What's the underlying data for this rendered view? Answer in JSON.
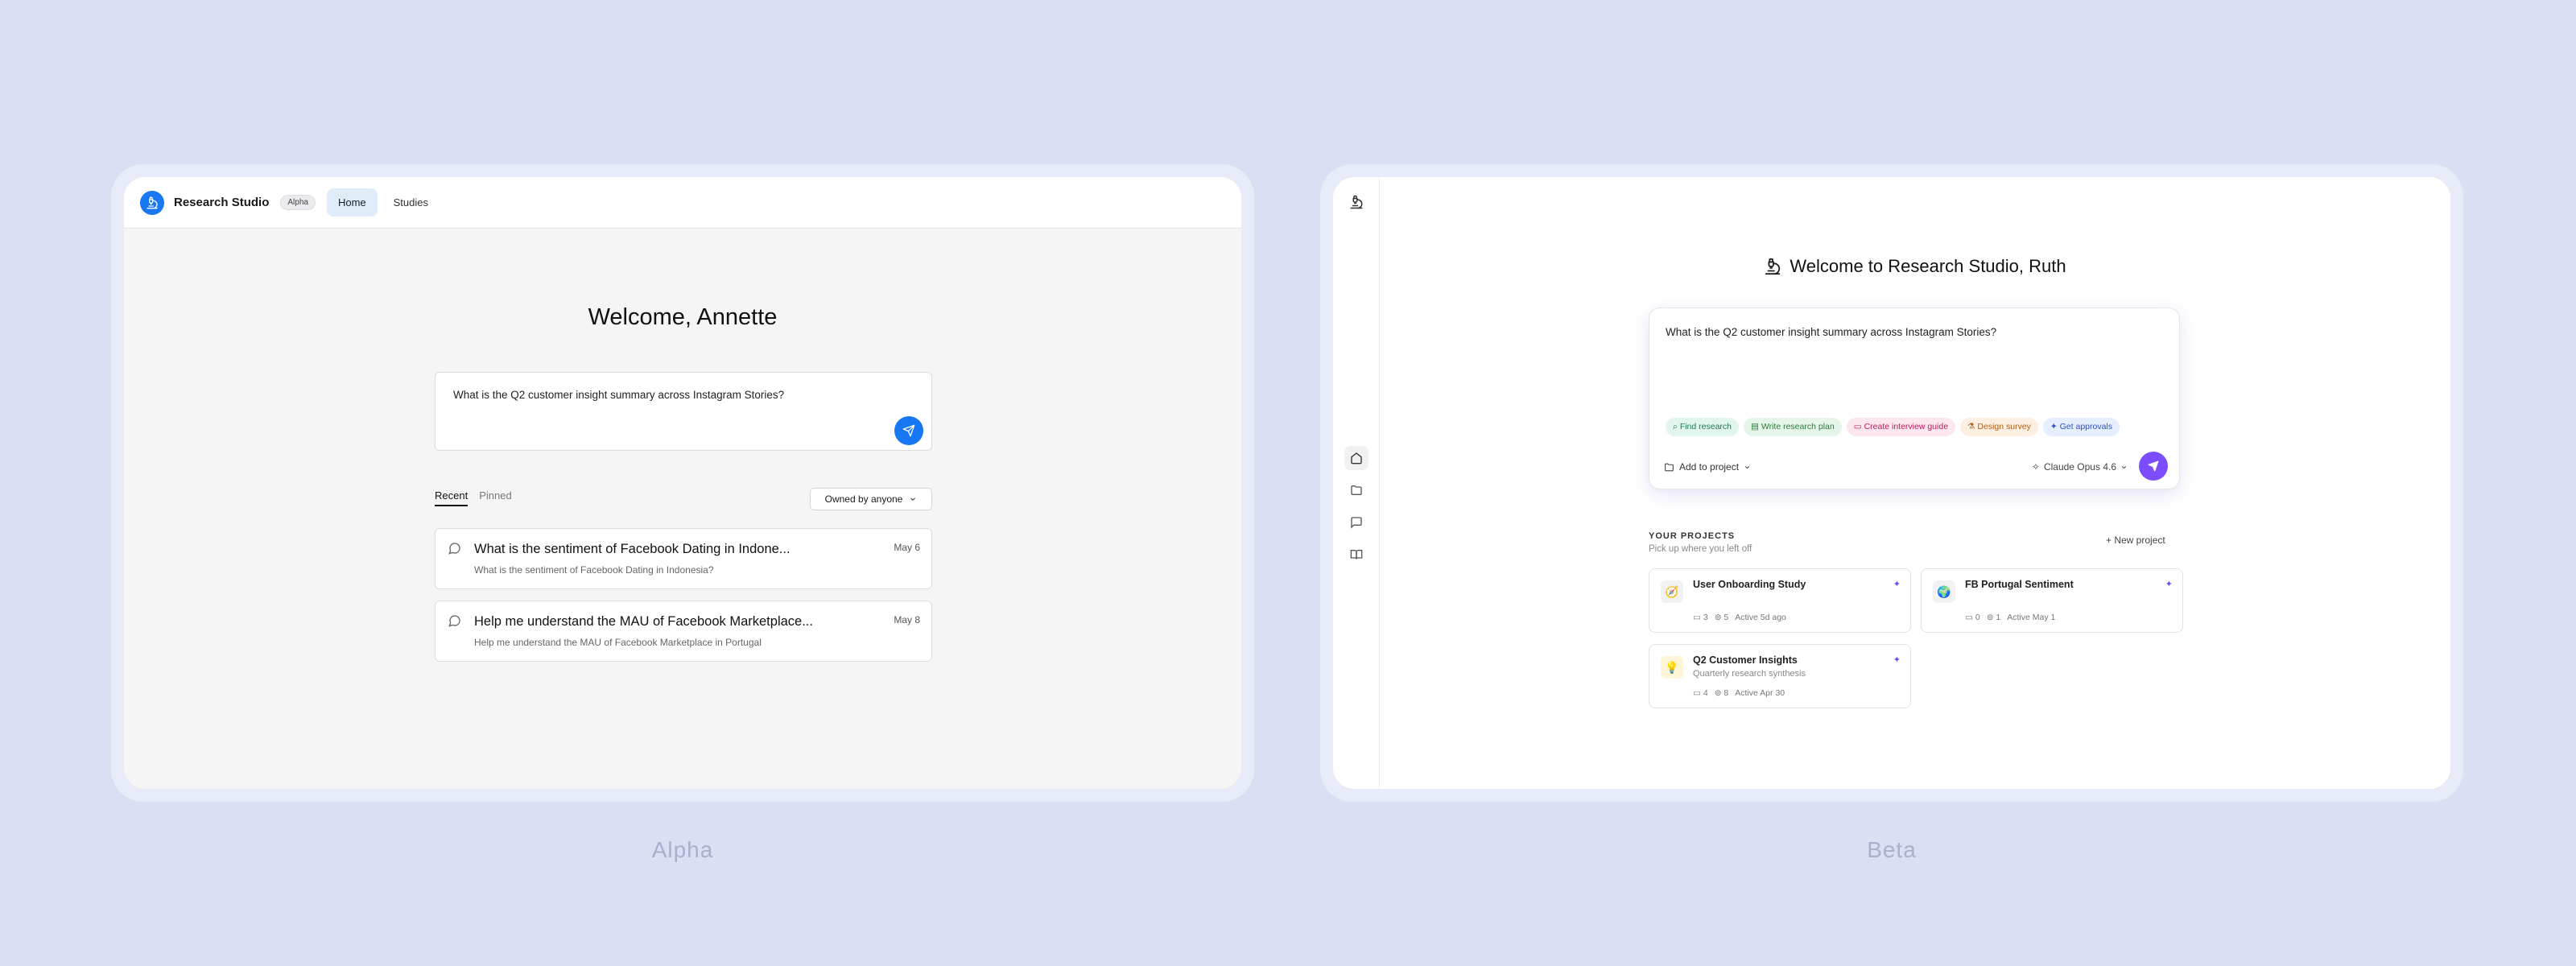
{
  "alpha": {
    "brand": "Research Studio",
    "badge": "Alpha",
    "nav": [
      {
        "label": "Home",
        "active": true
      },
      {
        "label": "Studies",
        "active": false
      }
    ],
    "welcome": "Welcome, Annette",
    "ask": {
      "value": "What is the Q2 customer insight summary across Instagram Stories?"
    },
    "tabs": [
      {
        "label": "Recent",
        "active": true
      },
      {
        "label": "Pinned",
        "active": false
      }
    ],
    "owner_filter": "Owned by anyone",
    "conversations": [
      {
        "title": "What is the sentiment of Facebook Dating in Indone...",
        "subtitle": "What is the sentiment of Facebook Dating in Indonesia?",
        "date": "May 6"
      },
      {
        "title": "Help me understand the MAU of Facebook Marketplace...",
        "subtitle": "Help me understand the MAU of Facebook Marketplace in Portugal",
        "date": "May 8"
      }
    ],
    "accent": "#1877f2"
  },
  "beta": {
    "welcome": "Welcome to Research Studio, Ruth",
    "ask": {
      "value": "What is the Q2 customer insight summary across Instagram Stories?"
    },
    "chips": [
      {
        "label": "Find research",
        "icon": "search-icon",
        "bg": "#e3f6ee",
        "fg": "#1c7a52"
      },
      {
        "label": "Write research plan",
        "icon": "document-icon",
        "bg": "#e6f5e9",
        "fg": "#2b7a3a"
      },
      {
        "label": "Create interview guide",
        "icon": "chat-icon",
        "bg": "#fde7ef",
        "fg": "#c2185b"
      },
      {
        "label": "Design survey",
        "icon": "survey-icon",
        "bg": "#fdf0e2",
        "fg": "#b25d10"
      },
      {
        "label": "Get approvals",
        "icon": "sparkle-icon",
        "bg": "#e6efff",
        "fg": "#2952cc"
      }
    ],
    "add_to_project": "Add to project",
    "model": "Claude Opus 4.6",
    "projects_heading": "YOUR PROJECTS",
    "projects_sub": "Pick up where you left off",
    "new_project": "New project",
    "projects": [
      {
        "title": "User Onboarding Study",
        "subtitle": "",
        "icon": "compass-icon",
        "chats": "3",
        "files": "5",
        "active": "Active 5d ago"
      },
      {
        "title": "FB Portugal Sentiment",
        "subtitle": "",
        "icon": "globe-icon",
        "chats": "0",
        "files": "1",
        "active": "Active May 1"
      },
      {
        "title": "Q2 Customer Insights",
        "subtitle": "Quarterly research synthesis",
        "icon": "lightbulb-icon",
        "chats": "4",
        "files": "8",
        "active": "Active Apr 30"
      }
    ],
    "accent": "#7c4dff"
  },
  "captions": {
    "alpha": "Alpha",
    "beta": "Beta"
  }
}
